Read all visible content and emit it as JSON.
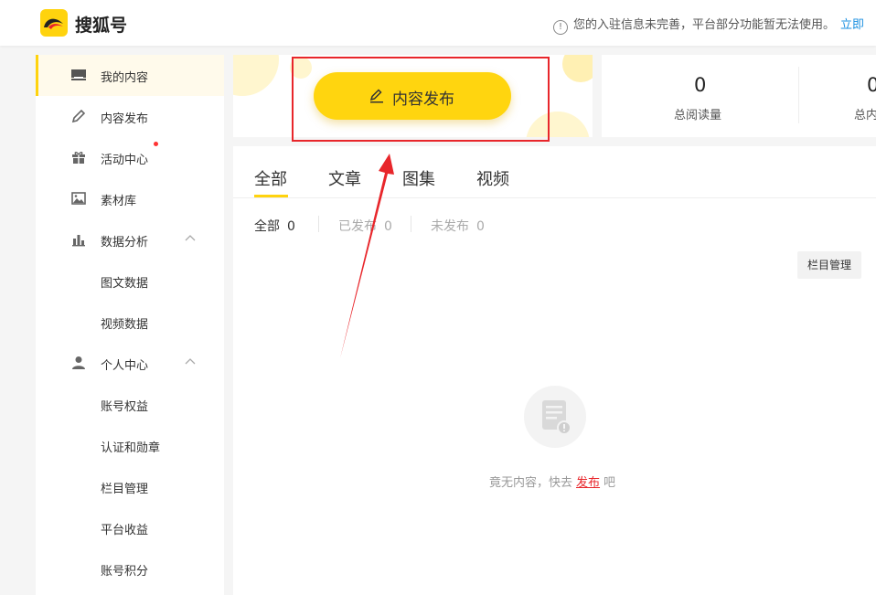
{
  "header": {
    "brand": "搜狐号",
    "notice": "您的入驻信息未完善，平台部分功能暂无法使用。",
    "notice_link": "立即"
  },
  "sidebar": {
    "items": [
      {
        "label": "我的内容",
        "icon": "inbox-icon",
        "active": true
      },
      {
        "label": "内容发布",
        "icon": "pencil-icon"
      },
      {
        "label": "活动中心",
        "icon": "gift-icon",
        "badge": "red-dot"
      },
      {
        "label": "素材库",
        "icon": "image-icon"
      },
      {
        "label": "数据分析",
        "icon": "bar-chart-icon",
        "expanded": true
      },
      {
        "label": "图文数据"
      },
      {
        "label": "视频数据"
      },
      {
        "label": "个人中心",
        "icon": "user-icon",
        "expanded": true
      },
      {
        "label": "账号权益"
      },
      {
        "label": "认证和勋章"
      },
      {
        "label": "栏目管理"
      },
      {
        "label": "平台收益"
      },
      {
        "label": "账号积分"
      }
    ]
  },
  "publish": {
    "label": "内容发布",
    "icon": "pencil-icon",
    "accent": "#ffd50f"
  },
  "stats": [
    {
      "value": "0",
      "label": "总阅读量"
    },
    {
      "value": "0",
      "label": "总内"
    }
  ],
  "tabs": [
    {
      "label": "全部",
      "active": true
    },
    {
      "label": "文章"
    },
    {
      "label": "图集"
    },
    {
      "label": "视频"
    }
  ],
  "filters": [
    {
      "label": "全部",
      "count": "0",
      "active": true
    },
    {
      "label": "已发布",
      "count": "0"
    },
    {
      "label": "未发布",
      "count": "0"
    }
  ],
  "column_manage": "栏目管理",
  "empty": {
    "before": "竟无内容，快去",
    "link": "发布",
    "after": "吧",
    "icon": "document-icon"
  },
  "colors": {
    "accent": "#ffd30e",
    "highlight_box": "#e8262b",
    "link": "#1a8fe0"
  }
}
